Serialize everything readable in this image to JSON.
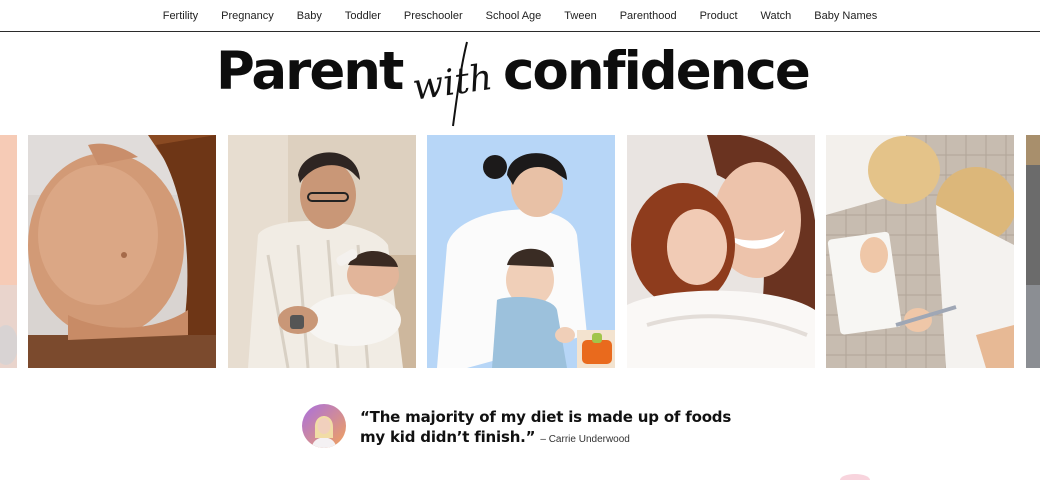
{
  "nav": {
    "items": [
      "Fertility",
      "Pregnancy",
      "Baby",
      "Toddler",
      "Preschooler",
      "School Age",
      "Tween",
      "Parenthood",
      "Product",
      "Watch",
      "Baby Names"
    ]
  },
  "hero": {
    "word1": "Parent",
    "script": "with",
    "word2": "confidence"
  },
  "photos": [
    {
      "name": "peach-partial-photo"
    },
    {
      "name": "pregnant-belly-photo"
    },
    {
      "name": "father-feeding-baby-photo"
    },
    {
      "name": "mother-playing-with-baby-photo"
    },
    {
      "name": "child-kissing-mother-photo"
    },
    {
      "name": "kids-drawing-photo"
    },
    {
      "name": "partial-photo-right"
    }
  ],
  "quote": {
    "text": "“The majority of my diet is made up of foods my kid didn’t finish.”",
    "attribution": "– Carrie Underwood"
  },
  "colors": {
    "text": "#111111",
    "accent_blue": "#b7d6f7",
    "peach": "#f6cbb6"
  }
}
